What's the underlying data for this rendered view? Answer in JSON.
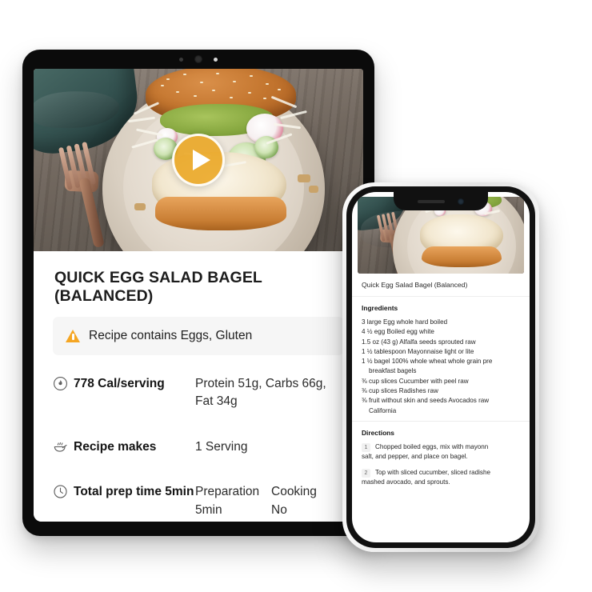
{
  "tablet": {
    "hero": {
      "image_alt": "egg salad bagel sandwich in a ceramic bowl on a wooden table",
      "play_icon": "play-icon"
    },
    "title": "QUICK EGG SALAD BAGEL (BALANCED)",
    "allergen": {
      "icon": "warning-triangle-icon",
      "text": "Recipe contains Eggs, Gluten",
      "accent_color": "#F5A623"
    },
    "rows": [
      {
        "icon": "flame-icon",
        "label": "778 Cal/serving",
        "value": "Protein 51g, Carbs 66g, Fat 34g"
      },
      {
        "icon": "bowl-steam-icon",
        "label": "Recipe makes",
        "value": "1 Serving"
      },
      {
        "icon": "clock-icon",
        "label": "Total prep time 5min",
        "col1_head": "Preparation",
        "col1_val": "5min",
        "col2_head": "Cooking",
        "col2_val": "No"
      }
    ]
  },
  "phone": {
    "title": "Quick Egg Salad Bagel (Balanced)",
    "ingredients_heading": "Ingredients",
    "ingredients": [
      {
        "line1": "3 large Egg whole hard boiled",
        "line2": ""
      },
      {
        "line1": "4 ½ egg Boiled egg white",
        "line2": ""
      },
      {
        "line1": "1.5 oz (43 g) Alfalfa seeds sprouted raw",
        "line2": ""
      },
      {
        "line1": "1 ½ tablespoon Mayonnaise light or lite",
        "line2": ""
      },
      {
        "line1": "1 ½ bagel 100% whole wheat whole grain pre",
        "line2": "breakfast bagels"
      },
      {
        "line1": "⅜ cup slices Cucumber with peel raw",
        "line2": ""
      },
      {
        "line1": "⅜ cup slices Radishes raw",
        "line2": ""
      },
      {
        "line1": "⅜ fruit without skin and seeds Avocados raw",
        "line2": "California"
      }
    ],
    "directions_heading": "Directions",
    "directions": [
      {
        "num": "1",
        "line1": "Chopped boiled eggs, mix with mayonn",
        "line2": "salt, and pepper, and place on bagel."
      },
      {
        "num": "2",
        "line1": "Top with sliced cucumber, sliced radishe",
        "line2": "mashed avocado, and sprouts."
      }
    ]
  }
}
